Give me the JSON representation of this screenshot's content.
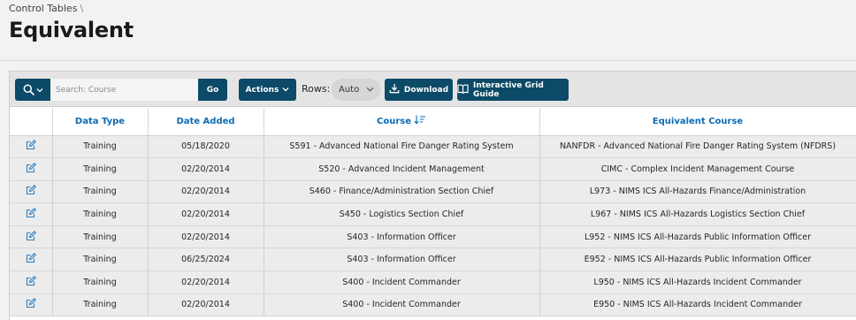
{
  "breadcrumb": {
    "parent": "Control Tables",
    "separator": "\\"
  },
  "page": {
    "title": "Equivalent"
  },
  "toolbar": {
    "search_placeholder": "Search: Course",
    "go_label": "Go",
    "actions_label": "Actions",
    "rows_label": "Rows:",
    "rows_value": "Auto",
    "download_label": "Download",
    "guide_label": "Interactive Grid Guide"
  },
  "grid": {
    "columns": [
      "Data Type",
      "Date Added",
      "Course",
      "Equivalent Course"
    ],
    "sorted_column": "Course",
    "rows": [
      {
        "data_type": "Training",
        "date_added": "05/18/2020",
        "course": "S591 - Advanced National Fire Danger Rating System",
        "equivalent": "NANFDR - Advanced National Fire Danger Rating System (NFDRS)"
      },
      {
        "data_type": "Training",
        "date_added": "02/20/2014",
        "course": "S520 - Advanced Incident Management",
        "equivalent": "CIMC - Complex Incident Management Course"
      },
      {
        "data_type": "Training",
        "date_added": "02/20/2014",
        "course": "S460 - Finance/Administration Section Chief",
        "equivalent": "L973 - NIMS ICS All-Hazards Finance/Administration"
      },
      {
        "data_type": "Training",
        "date_added": "02/20/2014",
        "course": "S450 - Logistics Section Chief",
        "equivalent": "L967 - NIMS ICS All-Hazards Logistics Section Chief"
      },
      {
        "data_type": "Training",
        "date_added": "02/20/2014",
        "course": "S403 - Information Officer",
        "equivalent": "L952 - NIMS ICS All-Hazards Public Information Officer"
      },
      {
        "data_type": "Training",
        "date_added": "06/25/2024",
        "course": "S403 - Information Officer",
        "equivalent": "E952 - NIMS ICS All-Hazards Public Information Officer"
      },
      {
        "data_type": "Training",
        "date_added": "02/20/2014",
        "course": "S400 - Incident Commander",
        "equivalent": "L950 - NIMS ICS All-Hazards Incident Commander"
      },
      {
        "data_type": "Training",
        "date_added": "02/20/2014",
        "course": "S400 - Incident Commander",
        "equivalent": "E950 - NIMS ICS All-Hazards Incident Commander"
      }
    ]
  },
  "colors": {
    "primary_button": "#0c4a67",
    "header_link": "#0b6bb5",
    "edit_icon": "#2f7fc1"
  }
}
